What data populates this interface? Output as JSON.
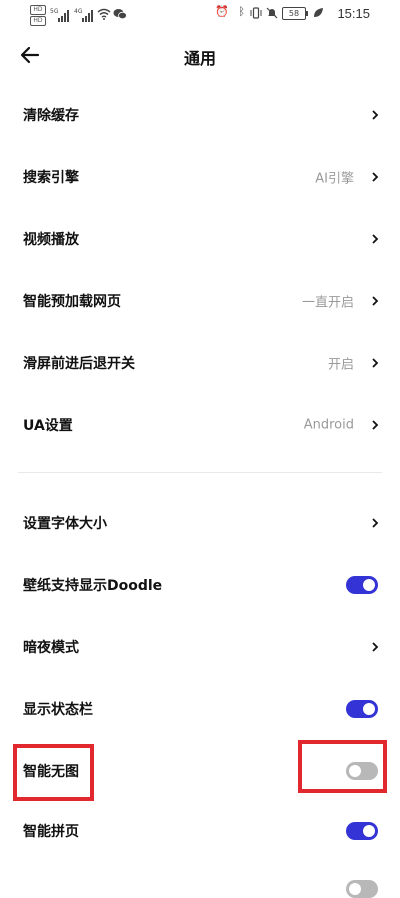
{
  "status_bar": {
    "left_badges": [
      "HD",
      "HD"
    ],
    "network_labels": [
      "5G",
      "4G"
    ],
    "battery": "58",
    "time": "15:15",
    "icons": [
      "alarm-icon",
      "bluetooth-icon",
      "vibrate-icon",
      "mute-icon",
      "battery-icon",
      "leaf-icon"
    ]
  },
  "header": {
    "title": "通用",
    "back_icon": "arrow-left-icon"
  },
  "section1": [
    {
      "label": "清除缓存",
      "value": ""
    },
    {
      "label": "搜索引擎",
      "value": "AI引擎"
    },
    {
      "label": "视频播放",
      "value": ""
    },
    {
      "label": "智能预加载网页",
      "value": "一直开启"
    },
    {
      "label": "滑屏前进后退开关",
      "value": "开启"
    },
    {
      "label": "UA设置",
      "value": "Android"
    }
  ],
  "section2": [
    {
      "label": "设置字体大小",
      "kind": "chevron"
    },
    {
      "label": "壁纸支持显示Doodle",
      "kind": "toggle",
      "on": true
    },
    {
      "label": "暗夜模式",
      "kind": "chevron"
    },
    {
      "label": "显示状态栏",
      "kind": "toggle",
      "on": true
    },
    {
      "label": "智能无图",
      "kind": "toggle",
      "on": false
    },
    {
      "label": "智能拼页",
      "kind": "toggle",
      "on": true
    }
  ],
  "colors": {
    "toggle_on": "#3333d6",
    "toggle_off": "#b8b8b8",
    "highlight": "#e0282e",
    "value_text": "#9a9a9a"
  }
}
